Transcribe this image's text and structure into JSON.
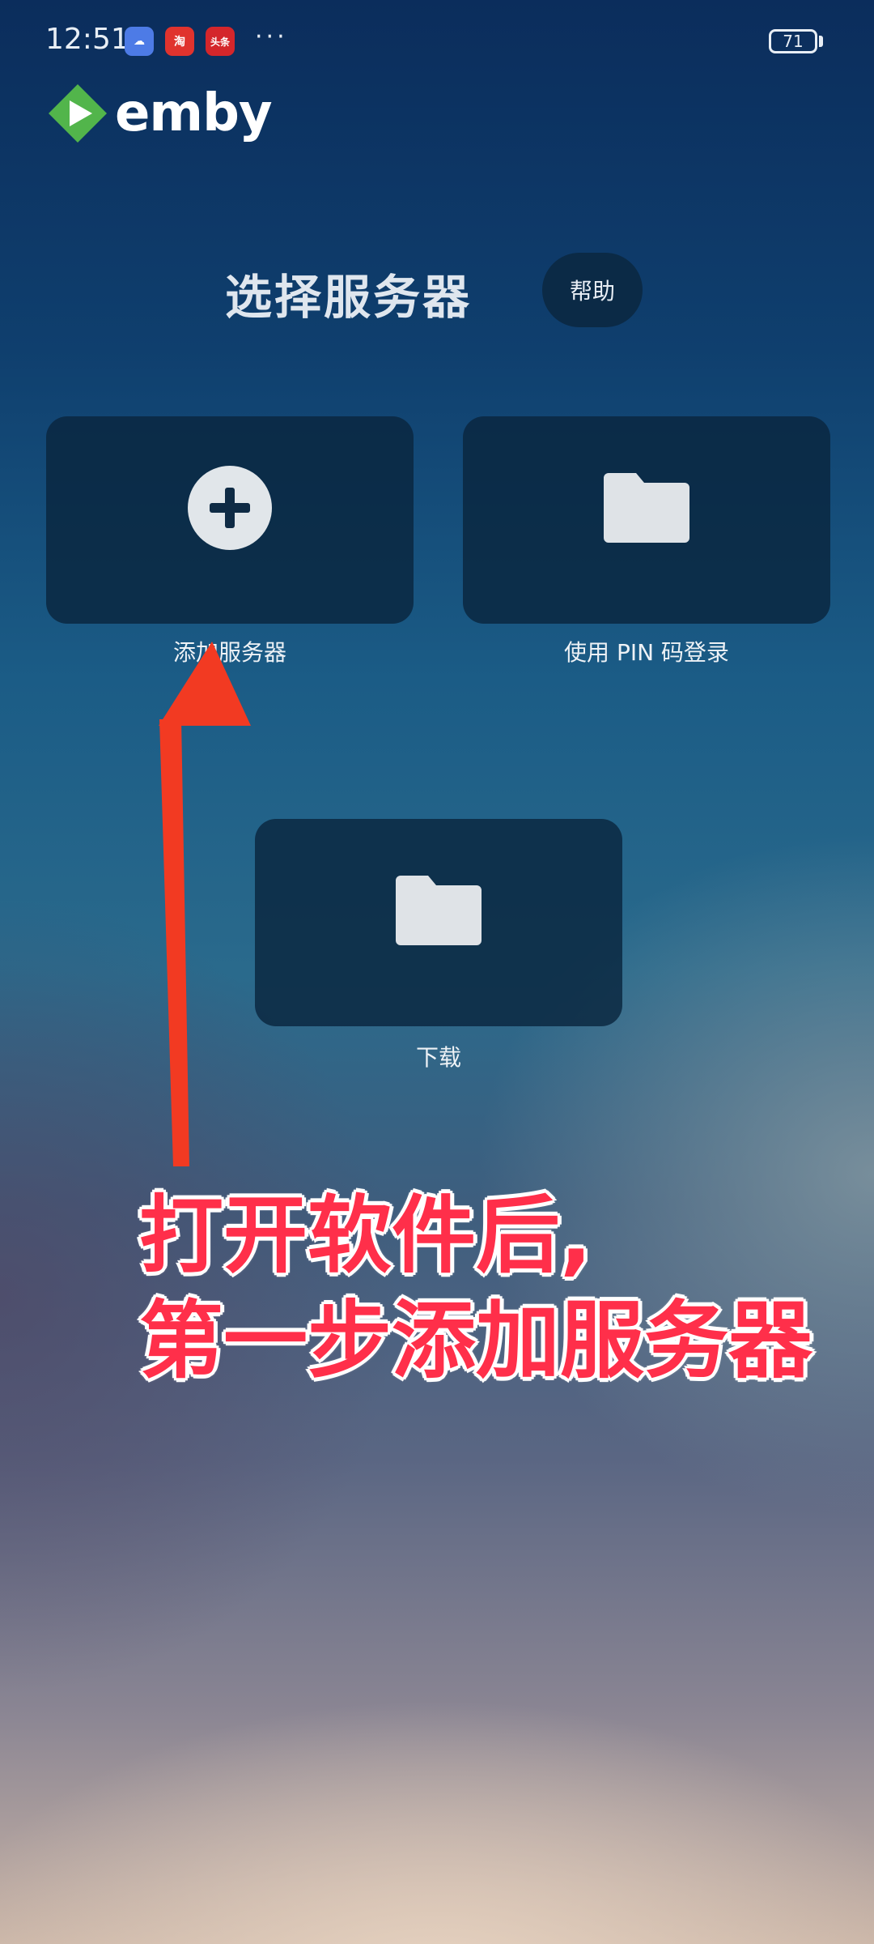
{
  "status_bar": {
    "time": "12:51",
    "apps": [
      {
        "name": "weather-app",
        "glyph": "☁"
      },
      {
        "name": "taobao-app",
        "glyph": "淘"
      },
      {
        "name": "toutiao-app",
        "glyph": "头条"
      }
    ],
    "more": "···",
    "battery": "71"
  },
  "logo": {
    "text": "emby",
    "brand_color": "#52b54b"
  },
  "page": {
    "title": "选择服务器",
    "help_label": "帮助"
  },
  "tiles": {
    "add_server": {
      "label": "添加服务器",
      "icon": "plus-circle-icon"
    },
    "pin_login": {
      "label": "使用 PIN 码登录",
      "icon": "folder-icon"
    },
    "download": {
      "label": "下载",
      "icon": "folder-icon"
    }
  },
  "annotation": {
    "line1": "打开软件后,",
    "line2": "第一步添加服务器",
    "color": "#ff2f4a"
  }
}
